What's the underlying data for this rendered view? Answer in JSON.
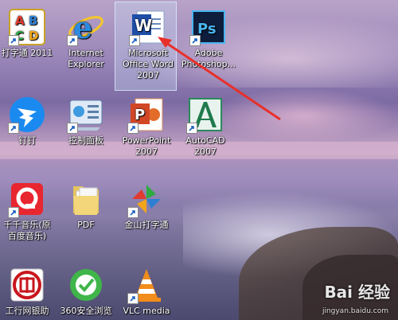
{
  "desktop": {
    "icons": [
      {
        "name": "dasang-tong-2011",
        "label": "打字通 2011",
        "icon": "abcd-icon",
        "shortcut": true
      },
      {
        "name": "internet-explorer",
        "label": "Internet\nExplorer",
        "icon": "ie-icon",
        "shortcut": true
      },
      {
        "name": "microsoft-office-word-2007",
        "label": "Microsoft\nOffice Word\n2007",
        "icon": "word-icon",
        "shortcut": true,
        "selected": true
      },
      {
        "name": "adobe-photoshop",
        "label": "Adobe\nPhotoshop...",
        "icon": "photoshop-icon",
        "shortcut": true
      },
      {
        "name": "dingding",
        "label": "钉钉",
        "icon": "dingtalk-icon",
        "shortcut": true
      },
      {
        "name": "control-panel",
        "label": "控制面板",
        "icon": "control-panel-icon",
        "shortcut": true
      },
      {
        "name": "powerpoint-2007",
        "label": "PowerPoint\n2007",
        "icon": "powerpoint-icon",
        "shortcut": true
      },
      {
        "name": "autocad-2007",
        "label": "AutoCAD\n2007",
        "icon": "autocad-icon",
        "shortcut": true
      },
      {
        "name": "qianqian-music",
        "label": "千千音乐(原\n百度音乐)",
        "icon": "music-icon",
        "shortcut": true
      },
      {
        "name": "pdf-folder",
        "label": "PDF",
        "icon": "folder-icon",
        "shortcut": false
      },
      {
        "name": "jinshan-dazitong",
        "label": "金山打字通",
        "icon": "pinwheel-icon",
        "shortcut": true
      },
      {
        "name": "icbc-bank",
        "label": "工行网银助",
        "icon": "icbc-icon",
        "shortcut": false
      },
      {
        "name": "360-browser",
        "label": "360安全浏览",
        "icon": "360-browser-icon",
        "shortcut": false
      },
      {
        "name": "vlc-media",
        "label": "VLC media",
        "icon": "vlc-icon",
        "shortcut": true
      }
    ]
  },
  "watermark": {
    "text": "Bai 经验",
    "url": "jingyan.baidu.com"
  },
  "colors": {
    "arrow": "#e8302a",
    "selection": "#c8dcf5"
  }
}
